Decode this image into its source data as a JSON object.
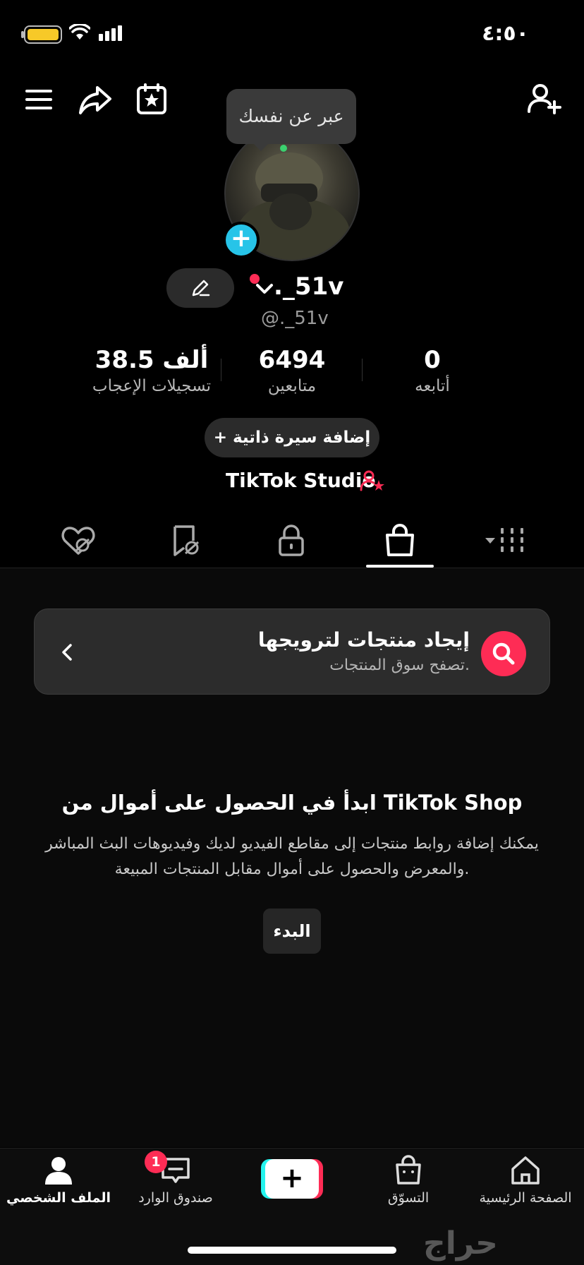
{
  "status_bar": {
    "time": "٤:٥٠"
  },
  "tooltip": {
    "text": "عبر عن نفسك"
  },
  "profile": {
    "username": "._51v",
    "handle": "@._51v",
    "stats": [
      {
        "value": "38.5 ألف",
        "label": "تسجيلات الإعجاب"
      },
      {
        "value": "6494",
        "label": "متابعين"
      },
      {
        "value": "0",
        "label": "أتابعه"
      }
    ],
    "add_bio_label": "+ إضافة سيرة ذاتية",
    "studio_label": "TikTok Studio"
  },
  "tabs": [
    {
      "name": "liked-videos",
      "icon": "heart-hidden-icon"
    },
    {
      "name": "favorites",
      "icon": "bookmark-hidden-icon"
    },
    {
      "name": "private",
      "icon": "lock-icon"
    },
    {
      "name": "shop",
      "icon": "shopping-bag-icon",
      "active": true
    },
    {
      "name": "videos",
      "icon": "grid-icon"
    }
  ],
  "find_products": {
    "title": "إيجاد منتجات لترويجها",
    "subtitle": "تصفح سوق المنتجات."
  },
  "shop_promo": {
    "title": "ابدأ في الحصول على أموال من TikTok Shop",
    "description": "يمكنك إضافة روابط منتجات إلى مقاطع الفيديو لديك وفيديوهات البث المباشر والمعرض والحصول على أموال مقابل المنتجات المبيعة.",
    "button": "البدء"
  },
  "bottom_nav": {
    "profile": "الملف الشخصي",
    "inbox": "صندوق الوارد",
    "inbox_badge": "1",
    "create": "+",
    "shop": "التسوّق",
    "home": "الصفحة الرئيسية"
  },
  "colors": {
    "accent": "#fe2c55",
    "cyan": "#25f4ee",
    "battery": "#f7c928"
  },
  "watermark": "حراج"
}
